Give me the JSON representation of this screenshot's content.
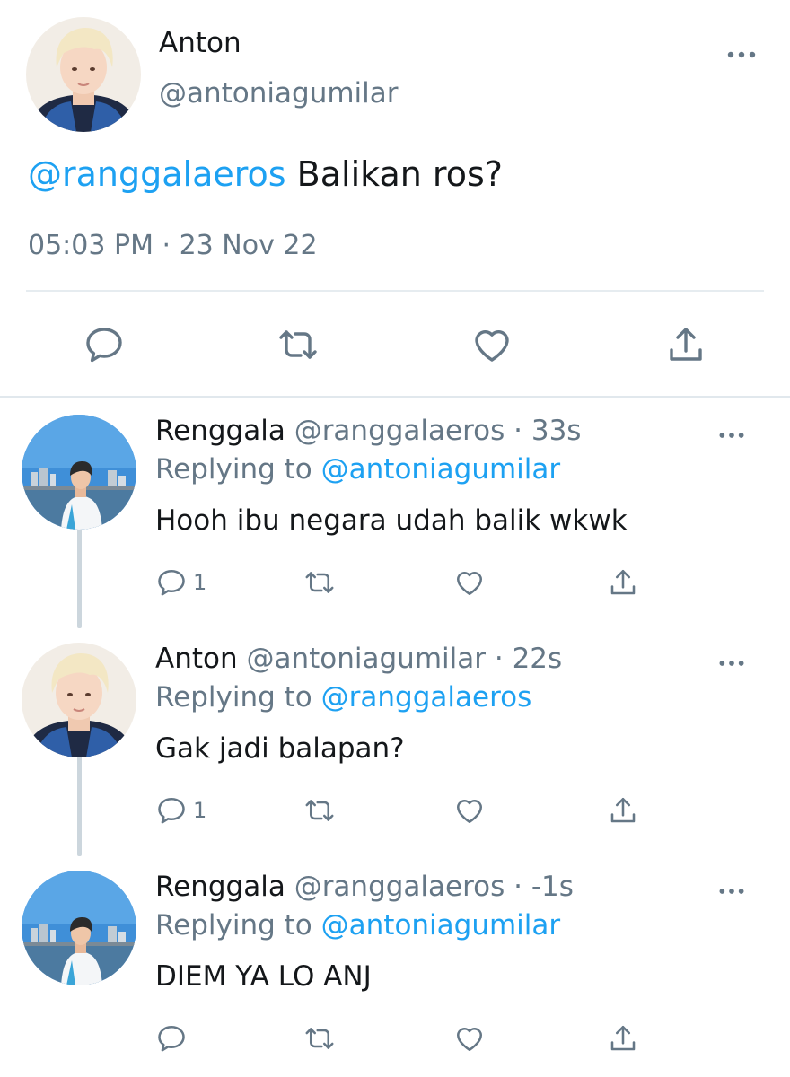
{
  "main_tweet": {
    "author_name": "Anton",
    "author_handle": "@antoniagumilar",
    "mention": "@ranggalaeros",
    "text": " Balikan ros?",
    "timestamp": "05:03 PM · 23 Nov 22",
    "actions": [
      "reply-icon",
      "retweet-icon",
      "like-icon",
      "share-icon"
    ]
  },
  "replies": [
    {
      "author_name": "Renggala",
      "author_handle": "@ranggalaeros",
      "time": "· 33s",
      "replying_label": "Replying to",
      "replying_handle": "@antoniagumilar",
      "text": "Hooh ibu negara udah balik wkwk",
      "reply_count": "1"
    },
    {
      "author_name": "Anton",
      "author_handle": "@antoniagumilar",
      "time": "· 22s",
      "replying_label": "Replying to",
      "replying_handle": "@ranggalaeros",
      "text": "Gak jadi balapan?",
      "reply_count": "1"
    },
    {
      "author_name": "Renggala",
      "author_handle": "@ranggalaeros",
      "time": "· -1s",
      "replying_label": "Replying to",
      "replying_handle": "@antoniagumilar",
      "text": "DIEM YA LO ANJ",
      "reply_count": ""
    }
  ],
  "colors": {
    "link": "#1da1f2",
    "muted": "#657786",
    "text": "#14171a",
    "divider": "#e1e8ed",
    "thread_line": "#ccd6dd"
  }
}
